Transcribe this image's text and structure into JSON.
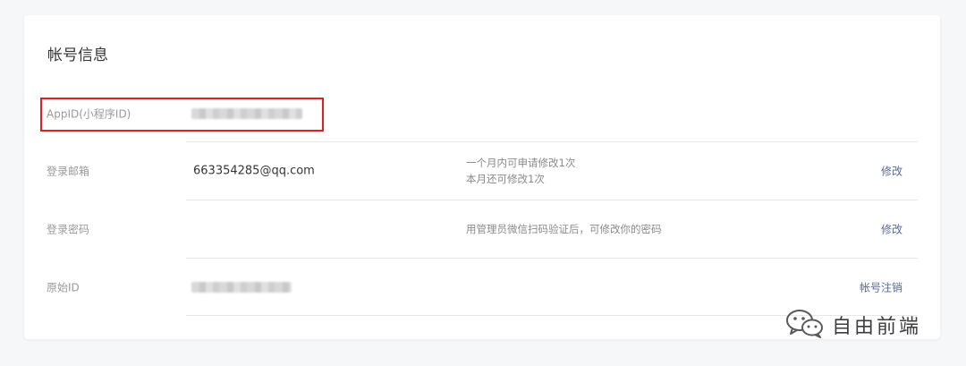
{
  "account": {
    "title": "帐号信息",
    "rows": [
      {
        "label": "AppID(小程序ID)"
      },
      {
        "label": "登录邮箱",
        "value": "663354285@qq.com",
        "desc": [
          "一个月内可申请修改1次",
          "本月还可修改1次"
        ],
        "action": "修改"
      },
      {
        "label": "登录密码",
        "desc": [
          "用管理员微信扫码验证后，可修改你的密码"
        ],
        "action": "修改"
      },
      {
        "label": "原始ID",
        "action": "帐号注销"
      }
    ]
  },
  "watermark": {
    "text": "自由前端",
    "icon": "wechat-icon"
  },
  "colors": {
    "link": "#576b95",
    "highlight": "#e02020",
    "label": "#9a9a9a"
  }
}
